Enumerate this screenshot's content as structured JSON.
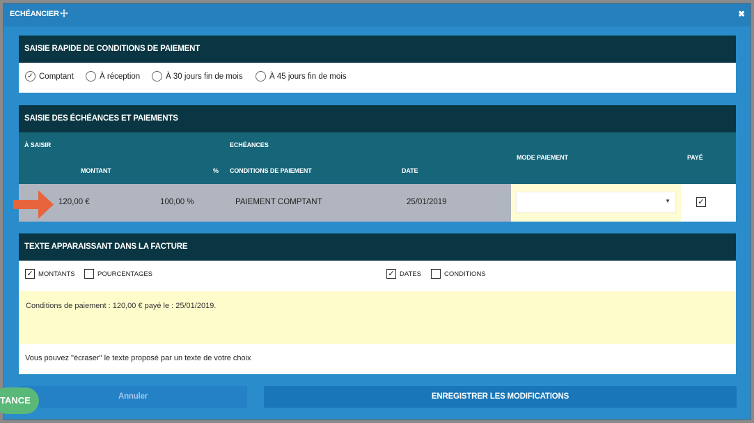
{
  "window": {
    "title": "ECHÉANCIER",
    "close_glyph": "✖"
  },
  "quick": {
    "header": "SAISIE RAPIDE DE CONDITIONS DE PAIEMENT",
    "options": [
      {
        "label": "Comptant",
        "checked": true
      },
      {
        "label": "À réception",
        "checked": false
      },
      {
        "label": "À 30 jours fin de mois",
        "checked": false
      },
      {
        "label": "À 45 jours fin de mois",
        "checked": false
      }
    ]
  },
  "schedule": {
    "header": "SAISIE DES ÉCHÉANCES ET PAIEMENTS",
    "columns": {
      "a_saisir": "À SAISIR",
      "montant": "MONTANT",
      "percent": "%",
      "echeances": "ECHÉANCES",
      "conditions": "CONDITIONS DE PAIEMENT",
      "date": "DATE",
      "mode": "MODE PAIEMENT",
      "paye": "PAYÉ"
    },
    "rows": [
      {
        "montant": "120,00 €",
        "percent": "100,00 %",
        "conditions": "PAIEMENT COMPTANT",
        "date": "25/01/2019",
        "mode": "",
        "paye": true
      }
    ]
  },
  "invoice_text": {
    "header": "TEXTE APPARAISSANT DANS LA FACTURE",
    "checks": [
      {
        "label": "MONTANTS",
        "checked": true
      },
      {
        "label": "POURCENTAGES",
        "checked": false
      },
      {
        "label": "DATES",
        "checked": true
      },
      {
        "label": "CONDITIONS",
        "checked": false
      }
    ],
    "text": "Conditions de paiement : 120,00 € payé le : 25/01/2019.",
    "note": "Vous pouvez \"écraser\" le texte proposé par un texte de votre choix"
  },
  "buttons": {
    "cancel": "Annuler",
    "save": "ENREGISTRER LES MODIFICATIONS",
    "assist": "TANCE"
  },
  "colors": {
    "header": "#093642",
    "subheader": "#176579",
    "frame": "#2a8ccb",
    "arrow": "#e8643c",
    "assist": "#5ab878"
  },
  "icons": [
    "move-icon",
    "close-icon",
    "radio-checked-icon",
    "checkbox-checked-icon",
    "dropdown-caret-icon",
    "arrow-right-icon"
  ]
}
